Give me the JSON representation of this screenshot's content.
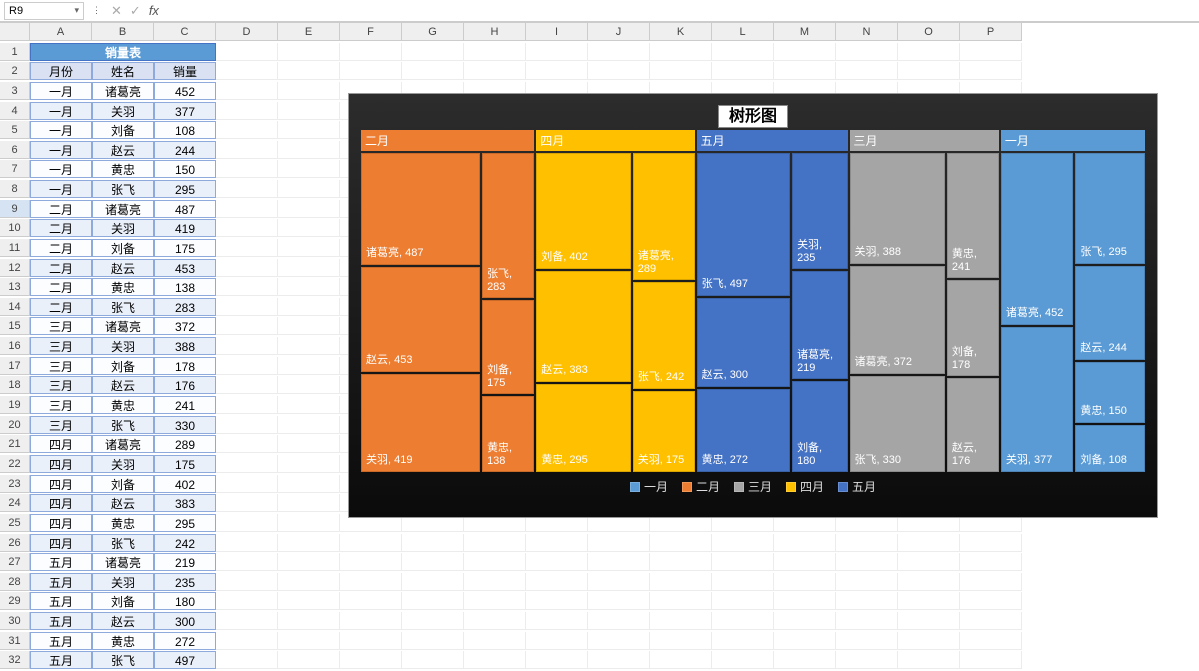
{
  "name_box": "R9",
  "formula": "",
  "columns": [
    "",
    "A",
    "B",
    "C",
    "D",
    "E",
    "F",
    "G",
    "H",
    "I",
    "J",
    "K",
    "L",
    "M",
    "N",
    "O",
    "P"
  ],
  "table_title": "销量表",
  "headers": [
    "月份",
    "姓名",
    "销量"
  ],
  "rows": [
    [
      "一月",
      "诸葛亮",
      "452"
    ],
    [
      "一月",
      "关羽",
      "377"
    ],
    [
      "一月",
      "刘备",
      "108"
    ],
    [
      "一月",
      "赵云",
      "244"
    ],
    [
      "一月",
      "黄忠",
      "150"
    ],
    [
      "一月",
      "张飞",
      "295"
    ],
    [
      "二月",
      "诸葛亮",
      "487"
    ],
    [
      "二月",
      "关羽",
      "419"
    ],
    [
      "二月",
      "刘备",
      "175"
    ],
    [
      "二月",
      "赵云",
      "453"
    ],
    [
      "二月",
      "黄忠",
      "138"
    ],
    [
      "二月",
      "张飞",
      "283"
    ],
    [
      "三月",
      "诸葛亮",
      "372"
    ],
    [
      "三月",
      "关羽",
      "388"
    ],
    [
      "三月",
      "刘备",
      "178"
    ],
    [
      "三月",
      "赵云",
      "176"
    ],
    [
      "三月",
      "黄忠",
      "241"
    ],
    [
      "三月",
      "张飞",
      "330"
    ],
    [
      "四月",
      "诸葛亮",
      "289"
    ],
    [
      "四月",
      "关羽",
      "175"
    ],
    [
      "四月",
      "刘备",
      "402"
    ],
    [
      "四月",
      "赵云",
      "383"
    ],
    [
      "四月",
      "黄忠",
      "295"
    ],
    [
      "四月",
      "张飞",
      "242"
    ],
    [
      "五月",
      "诸葛亮",
      "219"
    ],
    [
      "五月",
      "关羽",
      "235"
    ],
    [
      "五月",
      "刘备",
      "180"
    ],
    [
      "五月",
      "赵云",
      "300"
    ],
    [
      "五月",
      "黄忠",
      "272"
    ],
    [
      "五月",
      "张飞",
      "497"
    ]
  ],
  "selected_row": 9,
  "chart": {
    "title": "树形图",
    "legend": [
      {
        "label": "一月",
        "color": "#5b9bd5"
      },
      {
        "label": "二月",
        "color": "#ed7d31"
      },
      {
        "label": "三月",
        "color": "#a5a5a5"
      },
      {
        "label": "四月",
        "color": "#ffc000"
      },
      {
        "label": "五月",
        "color": "#4472c4"
      }
    ]
  },
  "chart_data": {
    "type": "treemap",
    "title": "树形图",
    "series": [
      {
        "name": "一月",
        "color": "#5b9bd5",
        "items": [
          {
            "label": "诸葛亮",
            "value": 452
          },
          {
            "label": "关羽",
            "value": 377
          },
          {
            "label": "张飞",
            "value": 295
          },
          {
            "label": "赵云",
            "value": 244
          },
          {
            "label": "黄忠",
            "value": 150
          },
          {
            "label": "刘备",
            "value": 108
          }
        ]
      },
      {
        "name": "二月",
        "color": "#ed7d31",
        "items": [
          {
            "label": "诸葛亮",
            "value": 487
          },
          {
            "label": "赵云",
            "value": 453
          },
          {
            "label": "关羽",
            "value": 419
          },
          {
            "label": "张飞",
            "value": 283
          },
          {
            "label": "刘备",
            "value": 175
          },
          {
            "label": "黄忠",
            "value": 138
          }
        ]
      },
      {
        "name": "三月",
        "color": "#a5a5a5",
        "items": [
          {
            "label": "关羽",
            "value": 388
          },
          {
            "label": "诸葛亮",
            "value": 372
          },
          {
            "label": "张飞",
            "value": 330
          },
          {
            "label": "黄忠",
            "value": 241
          },
          {
            "label": "刘备",
            "value": 178
          },
          {
            "label": "赵云",
            "value": 176
          }
        ]
      },
      {
        "name": "四月",
        "color": "#ffc000",
        "items": [
          {
            "label": "刘备",
            "value": 402
          },
          {
            "label": "赵云",
            "value": 383
          },
          {
            "label": "黄忠",
            "value": 295
          },
          {
            "label": "诸葛亮",
            "value": 289
          },
          {
            "label": "张飞",
            "value": 242
          },
          {
            "label": "关羽",
            "value": 175
          }
        ]
      },
      {
        "name": "五月",
        "color": "#4472c4",
        "items": [
          {
            "label": "张飞",
            "value": 497
          },
          {
            "label": "赵云",
            "value": 300
          },
          {
            "label": "黄忠",
            "value": 272
          },
          {
            "label": "关羽",
            "value": 235
          },
          {
            "label": "诸葛亮",
            "value": 219
          },
          {
            "label": "刘备",
            "value": 180
          }
        ]
      }
    ]
  }
}
